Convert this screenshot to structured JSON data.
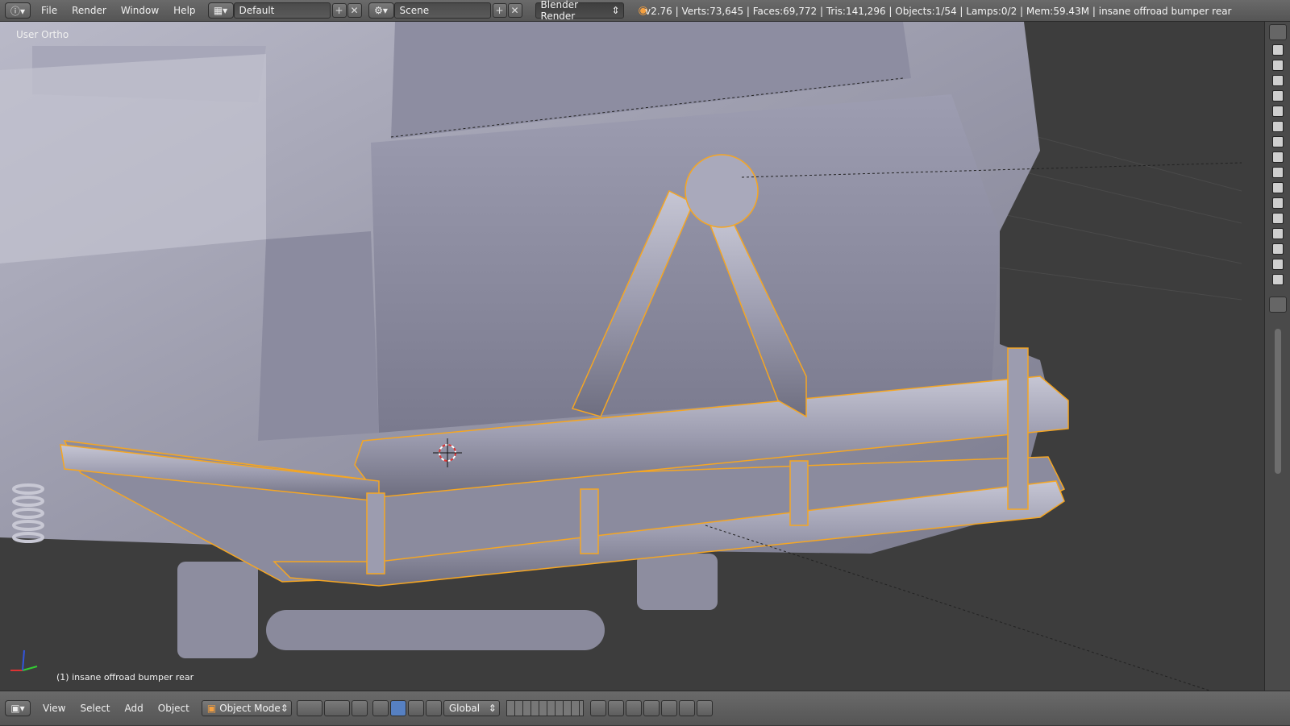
{
  "topbar": {
    "menus": [
      "File",
      "Render",
      "Window",
      "Help"
    ],
    "layout_name": "Default",
    "scene_name": "Scene",
    "render_engine": "Blender Render",
    "status_text": "v2.76 | Verts:73,645 | Faces:69,772 | Tris:141,296 | Objects:1/54 | Lamps:0/2 | Mem:59.43M | insane offroad bumper rear"
  },
  "viewport": {
    "view_label": "User Ortho",
    "object_label": "(1) insane offroad bumper rear"
  },
  "bottombar": {
    "menus": [
      "View",
      "Select",
      "Add",
      "Object"
    ],
    "mode": "Object Mode",
    "orientation": "Global"
  },
  "colors": {
    "selection_outline": "#f5a623",
    "background": "#3d3d3d",
    "header": "#5f5f5f"
  }
}
